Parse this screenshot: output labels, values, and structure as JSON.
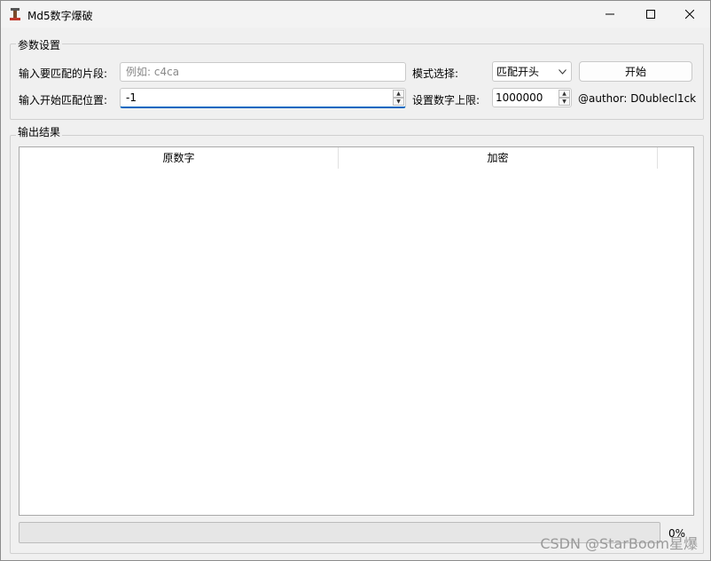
{
  "window": {
    "title": "Md5数字爆破",
    "controls": {
      "minimize": "minimize-icon",
      "maximize": "maximize-icon",
      "close": "close-icon"
    }
  },
  "params": {
    "group_title": "参数设置",
    "fragment_label": "输入要匹配的片段:",
    "fragment_value": "",
    "fragment_placeholder": "例如: c4ca",
    "start_pos_label": "输入开始匹配位置:",
    "start_pos_value": "-1",
    "mode_label": "模式选择:",
    "mode_selected": "匹配开头",
    "start_button": "开始",
    "limit_label": "设置数字上限:",
    "limit_value": "1000000",
    "author": "@author: D0ublecl1ck"
  },
  "output": {
    "group_title": "输出结果",
    "columns": [
      "原数字",
      "加密"
    ],
    "rows": []
  },
  "progress": {
    "value": 0,
    "label": "0%"
  },
  "watermark": "CSDN @StarBoom星爆",
  "colors": {
    "accent": "#0067c0",
    "progress_fill": "#06b025"
  }
}
